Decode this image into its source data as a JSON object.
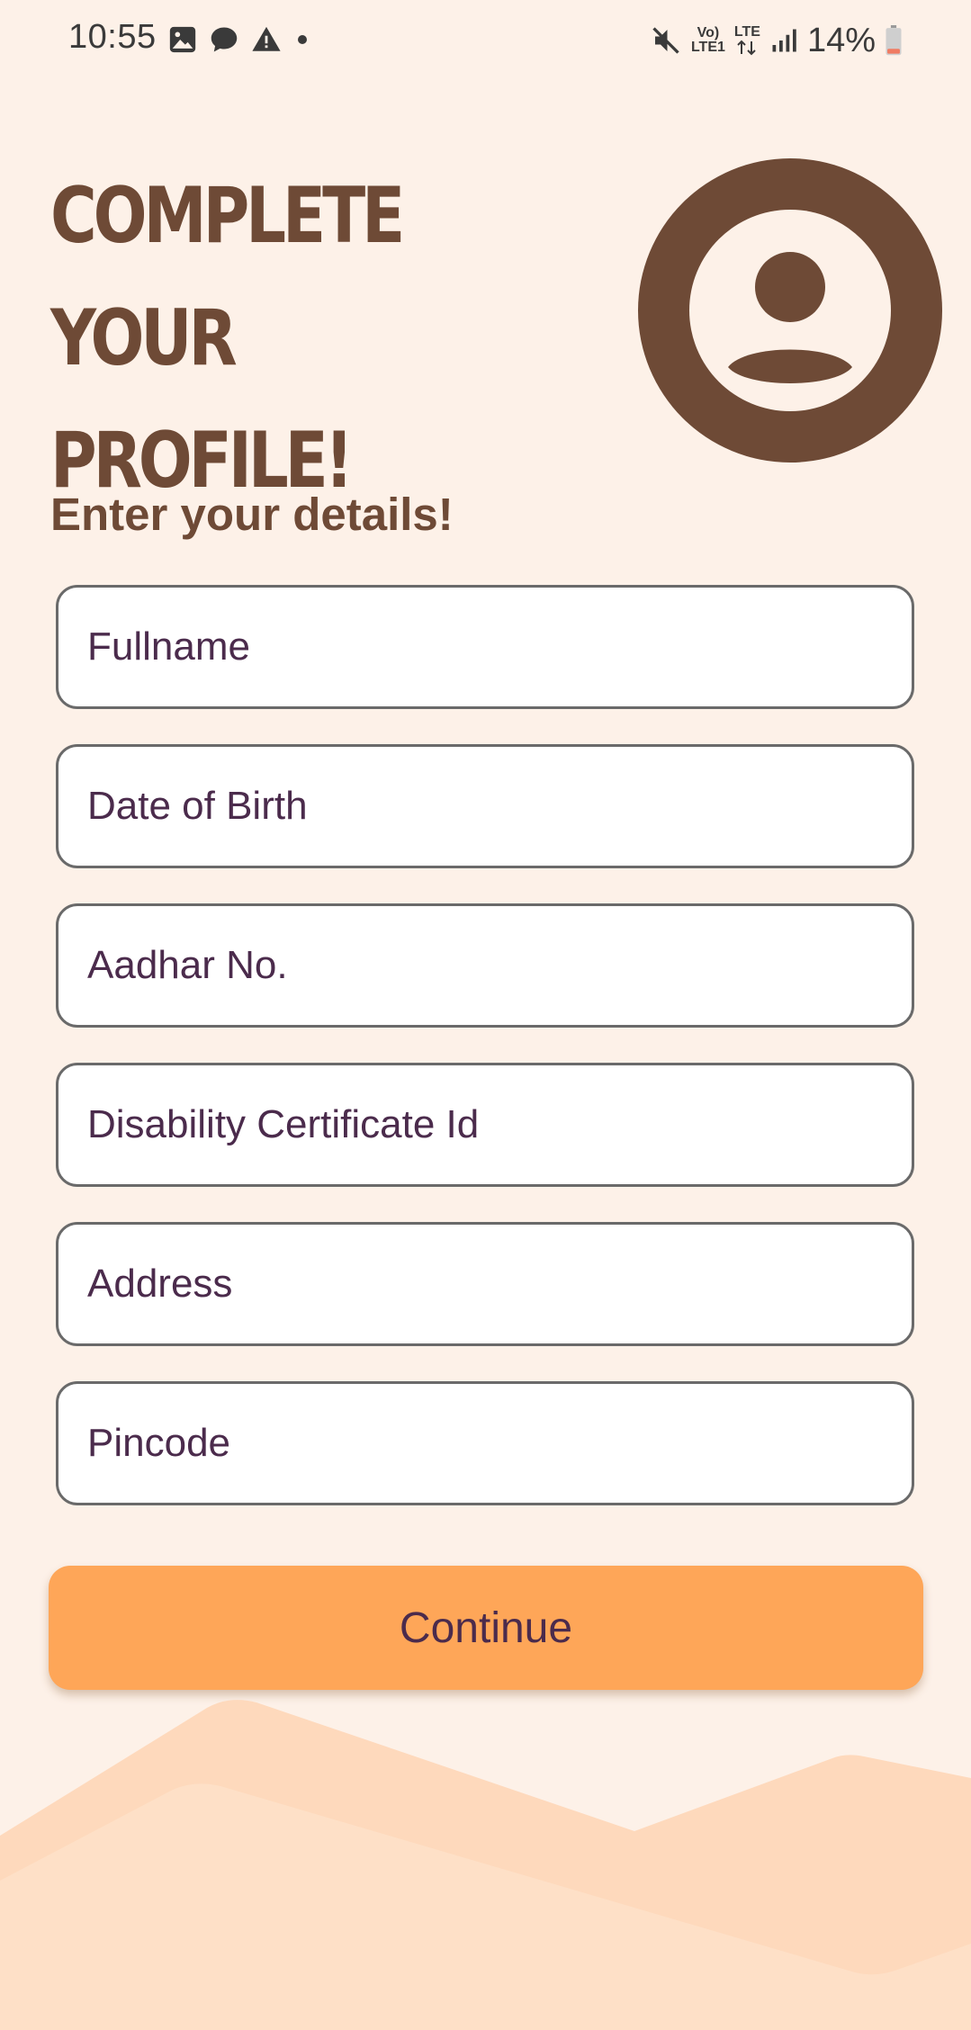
{
  "status_bar": {
    "time": "10:55",
    "battery": "14%",
    "net_top": "Vo)",
    "net_bottom": "LTE1",
    "lte_label": "LTE"
  },
  "header": {
    "title": "COMPLETE YOUR PROFILE!",
    "subtitle": "Enter your details!"
  },
  "form": {
    "fullname_placeholder": "Fullname",
    "dob_placeholder": "Date of Birth",
    "aadhar_placeholder": "Aadhar No.",
    "disability_placeholder": "Disability Certificate Id",
    "address_placeholder": "Address",
    "pincode_placeholder": "Pincode",
    "continue_label": "Continue"
  },
  "icons": {
    "avatar": "account-circle-icon",
    "gallery": "image-icon",
    "chat": "chat-bubble-icon",
    "alert": "warning-icon",
    "mute": "mute-icon",
    "signal": "signal-icon",
    "battery": "battery-icon"
  },
  "colors": {
    "background": "#fdf1e8",
    "title": "#6e4a36",
    "field_text": "#4b2b4c",
    "button": "#fea658",
    "mountain_back": "#fed9bc",
    "mountain_front": "#fedcc0"
  }
}
